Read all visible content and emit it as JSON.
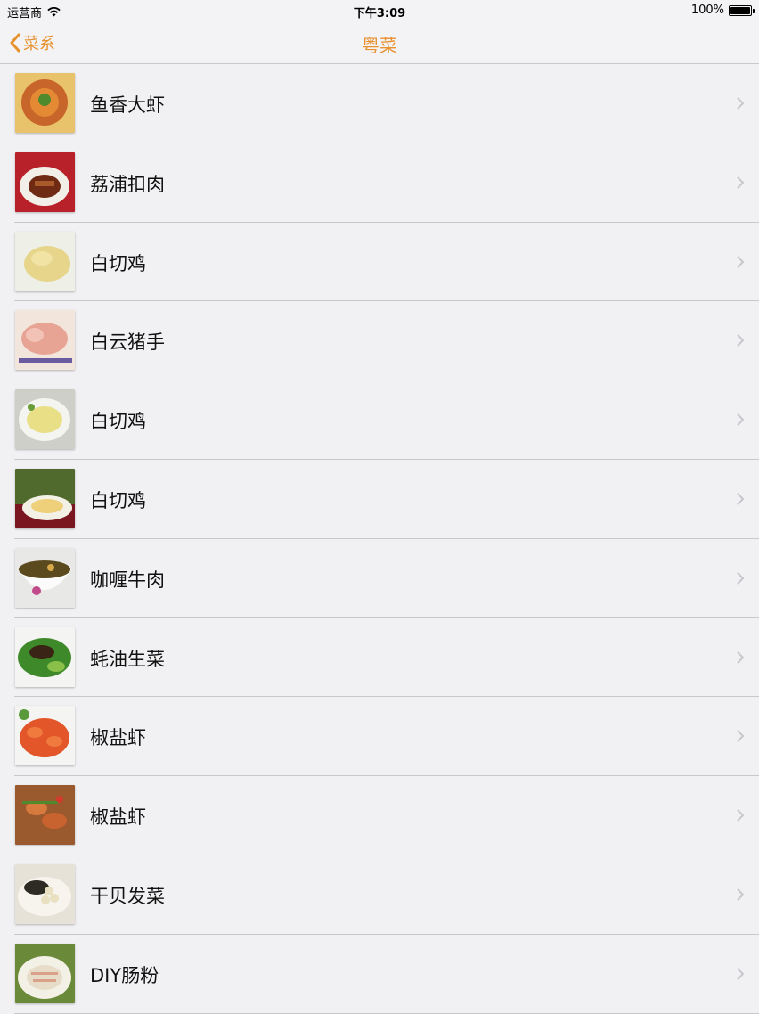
{
  "status_bar": {
    "carrier": "运营商",
    "time": "下午3:09",
    "battery": "100%"
  },
  "nav": {
    "back_label": "菜系",
    "title": "粤菜",
    "accent_color": "#e8912f"
  },
  "items": [
    {
      "label": "鱼香大虾",
      "icon": "dish-photo"
    },
    {
      "label": "荔浦扣肉",
      "icon": "dish-photo"
    },
    {
      "label": "白切鸡",
      "icon": "dish-photo"
    },
    {
      "label": "白云猪手",
      "icon": "dish-photo"
    },
    {
      "label": "白切鸡",
      "icon": "dish-photo"
    },
    {
      "label": "白切鸡",
      "icon": "dish-photo"
    },
    {
      "label": "咖喱牛肉",
      "icon": "dish-photo"
    },
    {
      "label": "蚝油生菜",
      "icon": "dish-photo"
    },
    {
      "label": "椒盐虾",
      "icon": "dish-photo"
    },
    {
      "label": "椒盐虾",
      "icon": "dish-photo"
    },
    {
      "label": "干贝发菜",
      "icon": "dish-photo"
    },
    {
      "label": "DIY肠粉",
      "icon": "dish-photo"
    }
  ]
}
